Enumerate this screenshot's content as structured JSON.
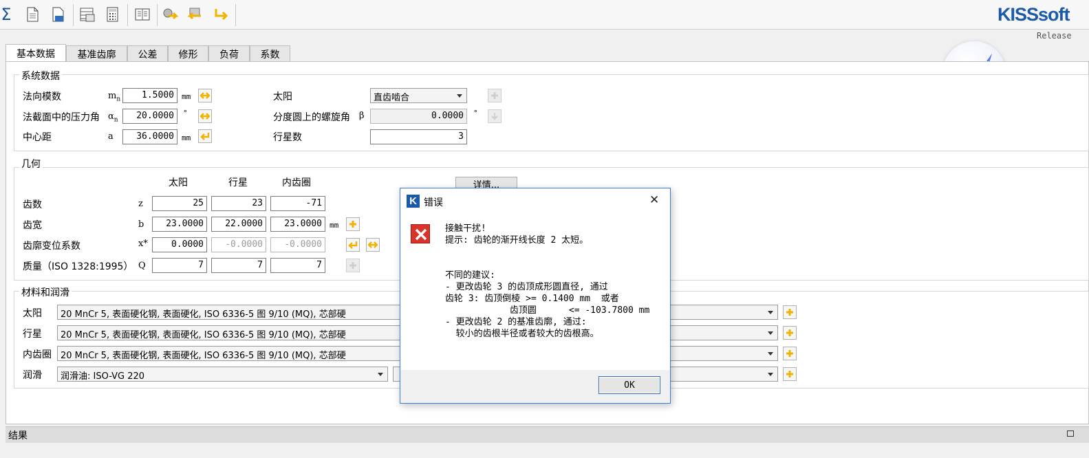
{
  "brand": {
    "name": "KISSsoft",
    "release": "Release"
  },
  "toolbar": {
    "icons": [
      "sum-icon",
      "new-document-icon",
      "open-file-icon",
      "database-icon",
      "calculator-icon",
      "book-icon",
      "gear-arrow-icon",
      "gear-arrow-alt-icon",
      "undo-arrow-icon"
    ],
    "sum_symbol": "Σ"
  },
  "tabs": [
    "基本数据",
    "基准齿廓",
    "公差",
    "修形",
    "负荷",
    "系数"
  ],
  "system": {
    "title": "系统数据",
    "rows": [
      {
        "label": "法向模数",
        "symbol": "mn",
        "value": "1.5000",
        "unit": "mm"
      },
      {
        "label": "法截面中的压力角",
        "symbol": "αn",
        "value": "20.0000",
        "unit": "°"
      },
      {
        "label": "中心距",
        "symbol": "a",
        "value": "36.0000",
        "unit": "mm"
      }
    ],
    "right": [
      {
        "label": "太阳",
        "value": "直齿啮合"
      },
      {
        "label": "分度圆上的螺旋角",
        "symbol": "β",
        "value": "0.0000",
        "unit": "°"
      },
      {
        "label": "行星数",
        "value": "3"
      }
    ]
  },
  "geometry": {
    "title": "几何",
    "columns": [
      "太阳",
      "行星",
      "内齿圈"
    ],
    "details_button": "详情...",
    "rows": [
      {
        "label": "齿数",
        "symbol": "z",
        "values": [
          "25",
          "23",
          "-71"
        ],
        "unit": ""
      },
      {
        "label": "齿宽",
        "symbol": "b",
        "values": [
          "23.0000",
          "22.0000",
          "23.0000"
        ],
        "unit": "mm"
      },
      {
        "label": "齿廓变位系数",
        "symbol": "x*",
        "values": [
          "0.0000",
          "-0.0000",
          "-0.0000"
        ],
        "unit": ""
      },
      {
        "label": "质量（ISO 1328:1995）",
        "symbol": "Q",
        "values": [
          "7",
          "7",
          "7"
        ],
        "unit": ""
      }
    ]
  },
  "material": {
    "title": "材料和润滑",
    "rows": [
      {
        "label": "太阳",
        "value": "20 MnCr 5, 表面硬化钢, 表面硬化, ISO 6336-5 图 9/10 (MQ), 芯部硬"
      },
      {
        "label": "行星",
        "value": "20 MnCr 5, 表面硬化钢, 表面硬化, ISO 6336-5 图 9/10 (MQ), 芯部硬"
      },
      {
        "label": "内齿圈",
        "value": "20 MnCr 5, 表面硬化钢, 表面硬化, ISO 6336-5 图 9/10 (MQ), 芯部硬"
      },
      {
        "label": "润滑",
        "value": "润滑油: ISO-VG 220"
      }
    ]
  },
  "results": {
    "title": "结果"
  },
  "dialog": {
    "title": "错误",
    "close_symbol": "✕",
    "message": "接触干扰!\n提示: 齿轮的渐开线长度 2 太短。\n\n\n不同的建议:\n- 更改齿轮 3 的齿顶成形圆直径, 通过\n齿轮 3: 齿顶倒棱 >= 0.1400 mm  或者\n            齿顶圆      <= -103.7800 mm\n- 更改齿轮 2 的基准齿廓, 通过:\n  较小的齿根半径或者较大的齿根高。",
    "ok_label": "OK"
  },
  "colors": {
    "accent": "#1a5aa8",
    "arrow_btn": "#f0b400",
    "error": "#d9342b"
  }
}
